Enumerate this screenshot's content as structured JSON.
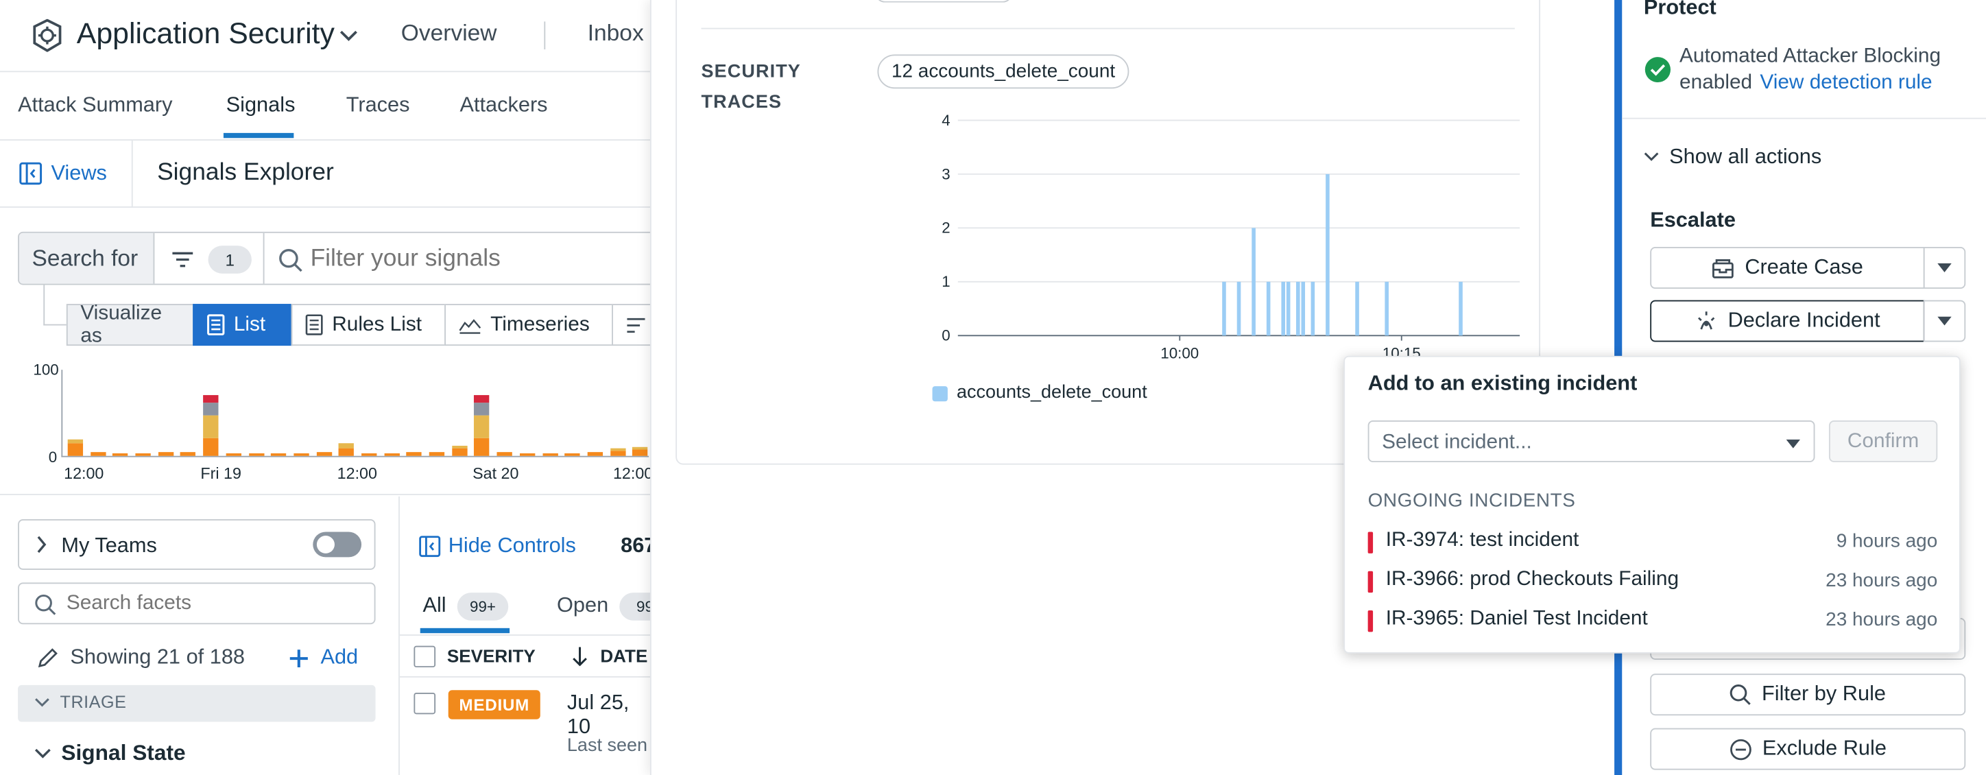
{
  "header": {
    "app_title": "Application Security",
    "nav": [
      "Overview",
      "Inbox"
    ]
  },
  "subnav": {
    "tabs": [
      "Attack Summary",
      "Signals",
      "Traces",
      "Attackers"
    ],
    "active": "Signals"
  },
  "views": {
    "views_label": "Views",
    "explorer_title": "Signals Explorer"
  },
  "search": {
    "search_for_label": "Search for",
    "filter_count": "1",
    "placeholder": "Filter your signals"
  },
  "visualize": {
    "label": "Visualize as",
    "options": [
      "List",
      "Rules List",
      "Timeseries"
    ],
    "active": "List"
  },
  "histogram": {
    "y_ticks": [
      "100",
      "0"
    ],
    "x_ticks": [
      "12:00",
      "Fri 19",
      "12:00",
      "Sat 20",
      "12:00"
    ],
    "colors": {
      "red": "#d6263d",
      "gray": "#8c93a0",
      "yellow": "#e6b74d",
      "orange": "#f5891c"
    }
  },
  "facets": {
    "my_teams_label": "My Teams",
    "search_placeholder": "Search facets",
    "showing": "Showing 21 of 188",
    "add_label": "Add",
    "triage_label": "TRIAGE",
    "signal_state_label": "Signal State"
  },
  "list": {
    "hide_controls": "Hide Controls",
    "count_partial": "867",
    "tabs": [
      {
        "label": "All",
        "badge": "99+"
      },
      {
        "label": "Open",
        "badge": "99"
      }
    ],
    "columns": [
      "SEVERITY",
      "DATE"
    ],
    "row": {
      "severity": "MEDIUM",
      "date": "Jul 25, 10",
      "last_seen": "Last seen"
    }
  },
  "traces": {
    "section_label_1": "SECURITY",
    "section_label_2": "TRACES",
    "chip": "12 accounts_delete_count",
    "legend": "accounts_delete_count",
    "legend_color": "#9bcdf5"
  },
  "chart_data": {
    "type": "bar",
    "title": "",
    "xlabel": "",
    "ylabel": "",
    "ylim": [
      0,
      4
    ],
    "y_ticks": [
      0,
      1,
      2,
      3,
      4
    ],
    "x_ticks": [
      "10:00",
      "10:15"
    ],
    "series": [
      {
        "name": "accounts_delete_count",
        "x": [
          "10:03",
          "10:04",
          "10:05",
          "10:06",
          "10:07",
          "10:07",
          "10:08",
          "10:08",
          "10:09",
          "10:10",
          "10:12",
          "10:14",
          "10:19"
        ],
        "values": [
          1,
          1,
          2,
          1,
          1,
          1,
          1,
          1,
          1,
          3,
          1,
          1,
          1
        ]
      }
    ]
  },
  "protect": {
    "title": "Protect",
    "status_line_1": "Automated Attacker Blocking",
    "status_line_2": "enabled",
    "link": "View detection rule",
    "status_color": "#1c9b52",
    "show_all": "Show all actions"
  },
  "escalate": {
    "title": "Escalate",
    "create_case": "Create Case",
    "declare_incident": "Declare Incident",
    "filter_by_rule": "Filter by Rule",
    "exclude_rule": "Exclude Rule"
  },
  "incident_popup": {
    "title": "Add to an existing incident",
    "select_placeholder": "Select incident...",
    "confirm": "Confirm",
    "section": "ONGOING INCIDENTS",
    "incidents": [
      {
        "name": "IR-3974: test incident",
        "time": "9 hours ago"
      },
      {
        "name": "IR-3966: prod Checkouts Failing",
        "time": "23 hours ago"
      },
      {
        "name": "IR-3965: Daniel Test Incident",
        "time": "23 hours ago"
      }
    ]
  }
}
